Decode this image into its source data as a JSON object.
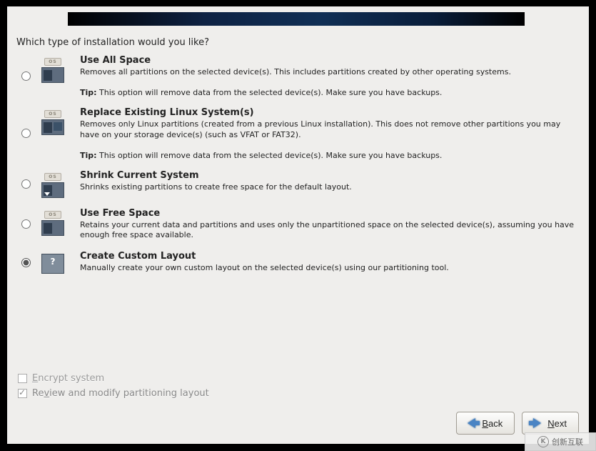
{
  "prompt": "Which type of installation would you like?",
  "options": [
    {
      "title": "Use All Space",
      "desc": "Removes all partitions on the selected device(s).  This includes partitions created by other operating systems.",
      "tip_label": "Tip:",
      "tip": " This option will remove data from the selected device(s).  Make sure you have backups.",
      "selected": false,
      "icon": "disk-all"
    },
    {
      "title": "Replace Existing Linux System(s)",
      "desc": "Removes only Linux partitions (created from a previous Linux installation).  This does not remove other partitions you may have on your storage device(s) (such as VFAT or FAT32).",
      "tip_label": "Tip:",
      "tip": " This option will remove data from the selected device(s).  Make sure you have backups.",
      "selected": false,
      "icon": "disk-replace"
    },
    {
      "title": "Shrink Current System",
      "desc": "Shrinks existing partitions to create free space for the default layout.",
      "selected": false,
      "icon": "disk-shrink"
    },
    {
      "title": "Use Free Space",
      "desc": "Retains your current data and partitions and uses only the unpartitioned space on the selected device(s), assuming you have enough free space available.",
      "selected": false,
      "icon": "disk-free"
    },
    {
      "title": "Create Custom Layout",
      "desc": "Manually create your own custom layout on the selected device(s) using our partitioning tool.",
      "selected": true,
      "icon": "disk-custom"
    }
  ],
  "checks": {
    "encrypt": {
      "label_pre": "E",
      "label_post": "ncrypt system",
      "checked": false
    },
    "review": {
      "label_pre": "Re",
      "label_ul": "v",
      "label_post": "iew and modify partitioning layout",
      "checked": true
    }
  },
  "nav": {
    "back_ul": "B",
    "back_rest": "ack",
    "next_ul": "N",
    "next_rest": "ext"
  },
  "watermark": "创新互联",
  "os_tab": "OS"
}
